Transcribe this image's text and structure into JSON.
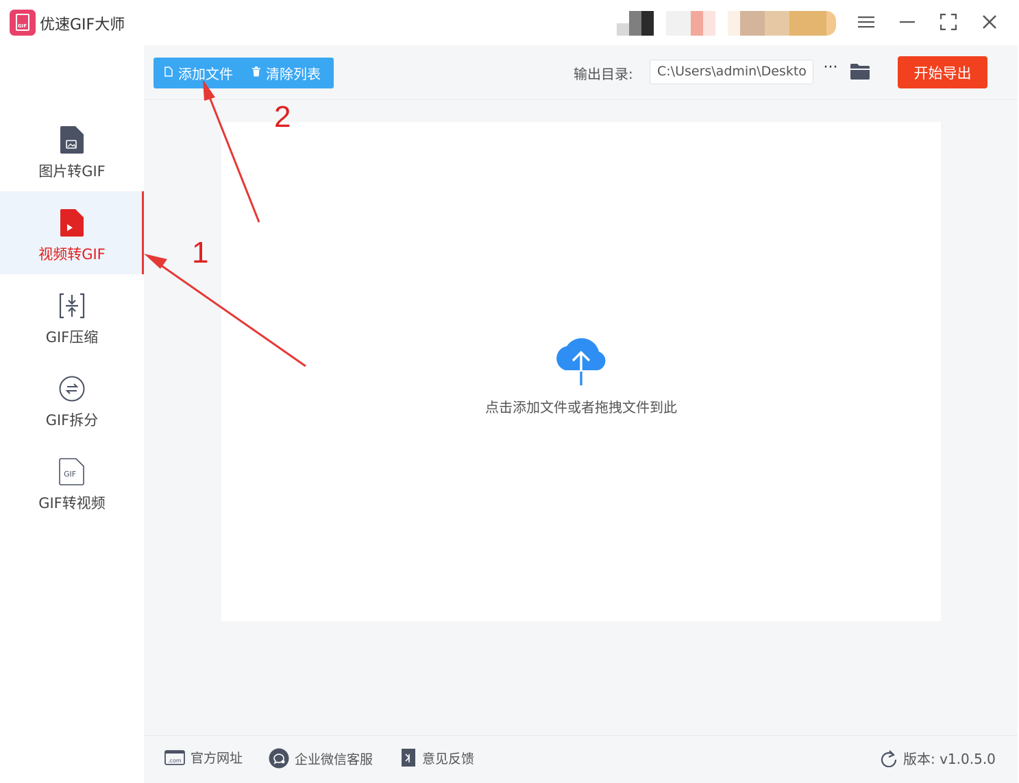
{
  "app": {
    "title": "优速GIF大师",
    "logo_text": "GIF"
  },
  "window_controls": [
    "menu-icon",
    "minimize-icon",
    "maximize-icon",
    "close-icon"
  ],
  "sidebar": {
    "items": [
      {
        "label": "图片转GIF",
        "icon": "image-file-icon",
        "active": false
      },
      {
        "label": "视频转GIF",
        "icon": "video-file-icon",
        "active": true
      },
      {
        "label": "GIF压缩",
        "icon": "compress-icon",
        "active": false
      },
      {
        "label": "GIF拆分",
        "icon": "split-icon",
        "active": false
      },
      {
        "label": "GIF转视频",
        "icon": "gif-file-icon",
        "active": false
      }
    ]
  },
  "toolbar": {
    "add_files": "添加文件",
    "clear_list": "清除列表",
    "output_label": "输出目录:",
    "output_path": "C:\\Users\\admin\\Deskto",
    "more": "···",
    "export": "开始导出"
  },
  "dropzone": {
    "hint": "点击添加文件或者拖拽文件到此"
  },
  "footer": {
    "website": "官方网址",
    "website_icon_text": ".com",
    "wechat": "企业微信客服",
    "feedback": "意见反馈",
    "version": "版本: v1.0.5.0"
  },
  "annotations": {
    "step1": "1",
    "step2": "2"
  },
  "colors": {
    "accent_blue": "#3aa7f3",
    "export_red": "#f1411f",
    "active_red": "#e02020",
    "logo_pink": "#e8426a"
  }
}
